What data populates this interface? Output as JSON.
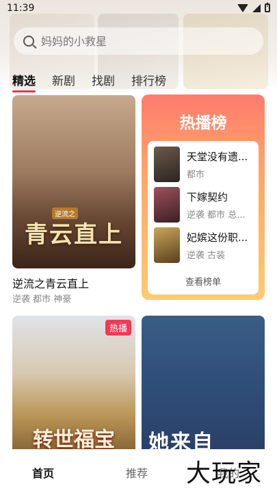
{
  "status": {
    "time": "11:39"
  },
  "search": {
    "placeholder": "妈妈的小救星"
  },
  "tabs": [
    {
      "label": "精选"
    },
    {
      "label": "新剧"
    },
    {
      "label": "找剧"
    },
    {
      "label": "排行榜"
    }
  ],
  "featured": {
    "poster_text": "青云直上",
    "poster_small_text": "逆流之",
    "title": "逆流之青云直上",
    "tags": "逆袭 都市 神豪"
  },
  "hot_board": {
    "title": "热播榜",
    "items": [
      {
        "name": "天堂没有遗...",
        "tags": "都市"
      },
      {
        "name": "下嫁契约",
        "tags": "逆袭 都市 总..."
      },
      {
        "name": "妃嫔这份职...",
        "tags": "逆袭 古装"
      }
    ],
    "more_label": "查看榜单"
  },
  "row2": [
    {
      "poster_text": "转世福宝",
      "badge": "热播"
    },
    {
      "poster_text": "她来自"
    }
  ],
  "bottom_nav": [
    {
      "label": "首页"
    },
    {
      "label": "推荐"
    },
    {
      "label": "我的"
    }
  ],
  "watermark": "大玩家",
  "colors": {
    "accent": "#e8344e",
    "hot_top": "#ff7b6d",
    "hot_bottom": "#ffcb6f"
  }
}
